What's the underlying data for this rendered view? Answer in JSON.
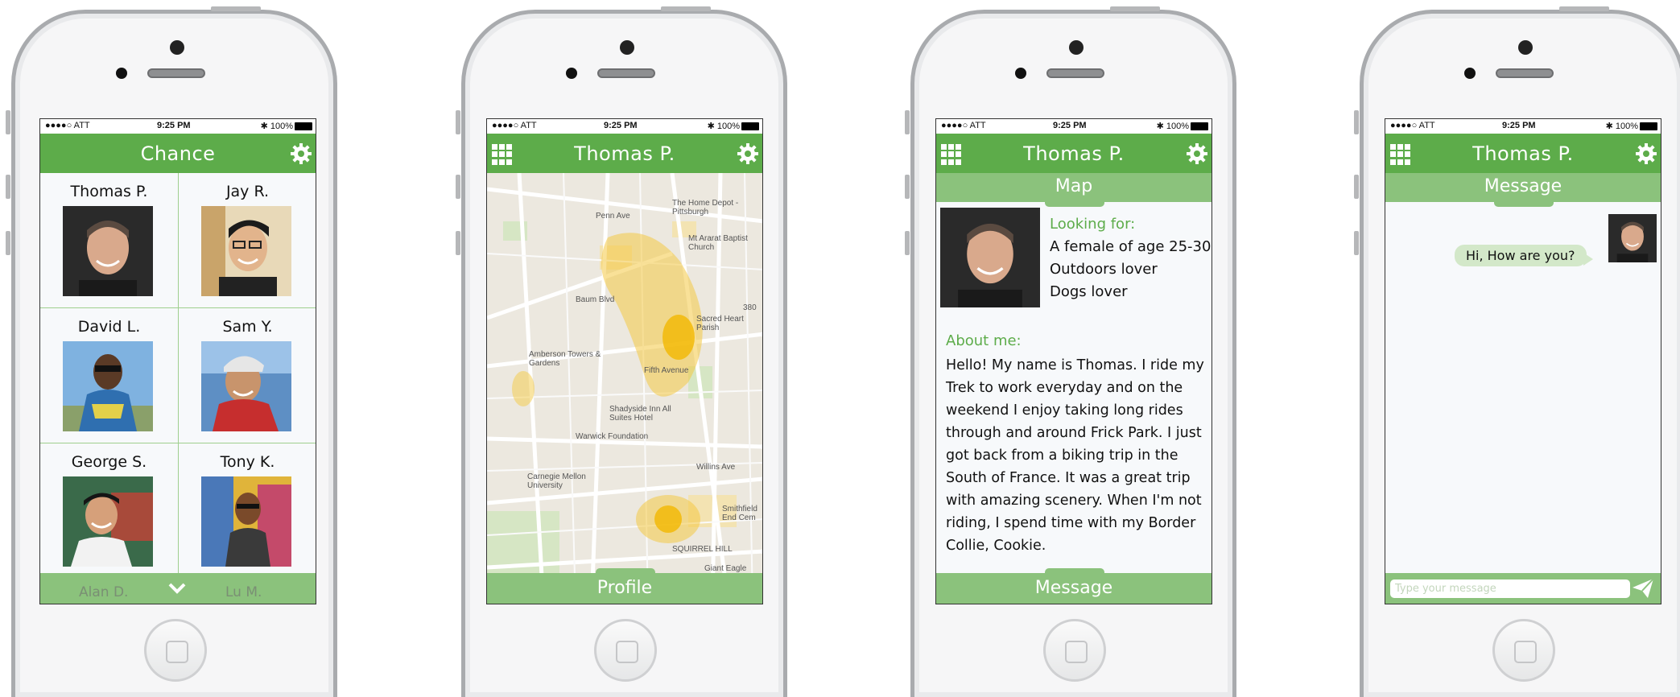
{
  "status_bar": {
    "carrier": "●●●●○ ATT",
    "time": "9:25 PM",
    "battery": "100%"
  },
  "colors": {
    "brand_green": "#5dac4a",
    "light_green": "#8bc27c",
    "bubble": "#d3e8c9"
  },
  "screen1": {
    "title": "Chance",
    "people": [
      {
        "name": "Thomas P."
      },
      {
        "name": "Jay R."
      },
      {
        "name": "David L."
      },
      {
        "name": "Sam Y."
      },
      {
        "name": "George S."
      },
      {
        "name": "Tony K."
      }
    ],
    "partial_names": [
      "Alan D.",
      "Lu M."
    ]
  },
  "screen2": {
    "title": "Thomas P.",
    "bottom_button": "Profile",
    "map_labels": {
      "amberson": "Amberson Towers & Gardens",
      "shadyside": "Shadyside Inn All Suites Hotel",
      "warwick": "Warwick Foundation",
      "cmu": "Carnegie Mellon University",
      "home_depot": "The Home Depot - Pittsburgh",
      "mt_ararat": "Mt Ararat Baptist Church",
      "sacred_heart": "Sacred Heart Parish",
      "smithfield": "Smithfield End Cem",
      "giant_eagle": "Giant Eagle",
      "squirrel_hill": "SQUIRREL HILL",
      "penn_ave": "Penn Ave",
      "baum_blvd": "Baum Blvd",
      "fifth_ave": "Fifth Avenue",
      "willins_ave": "Willins Ave",
      "route": "380"
    }
  },
  "screen3": {
    "title": "Thomas P.",
    "tab": "Map",
    "looking_for_label": "Looking for:",
    "looking_for": [
      "A female of age 25-30",
      "Outdoors lover",
      "Dogs lover"
    ],
    "about_label": "About me:",
    "about_text": "Hello! My name is Thomas. I ride my Trek to work everyday and on the weekend I enjoy taking long rides through and around Frick Park. I just got back from a biking trip in the South of France. It was a great trip with amazing scenery. When I'm not riding, I spend time with my Border Collie, Cookie.",
    "bottom_button": "Message"
  },
  "screen4": {
    "title": "Thomas P.",
    "tab": "Message",
    "messages": [
      {
        "text": "Hi, How are you?"
      }
    ],
    "input_placeholder": "Type your message"
  }
}
